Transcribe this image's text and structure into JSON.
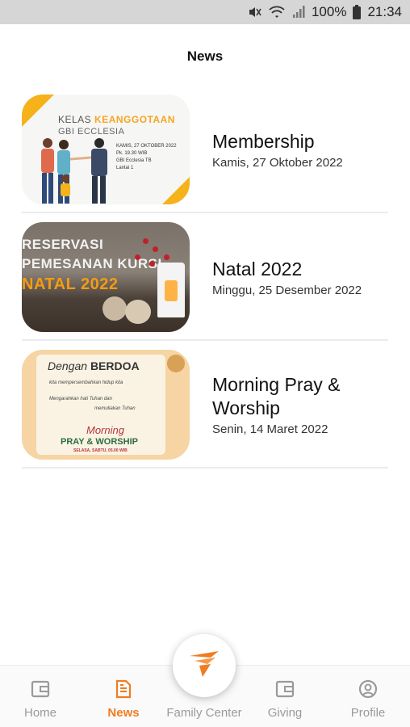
{
  "status_bar": {
    "battery": "100%",
    "time": "21:34"
  },
  "header": {
    "title": "News"
  },
  "news": [
    {
      "title": "Membership",
      "date": "Kamis, 27 Oktober 2022",
      "thumb": {
        "kelas": "KELAS ",
        "keanggotaan": "KEANGGOTAAN",
        "gbi": "GBI ECCLESIA",
        "info1": "KAMIS, 27 OKTOBER 2022",
        "info2": "Pk. 19.30 WIB",
        "info3": "GBI Ecclesia TB",
        "info4": "Lantai 1"
      }
    },
    {
      "title": "Natal 2022",
      "date": "Minggu, 25 Desember 2022",
      "thumb": {
        "line1": "RESERVASI",
        "line2": "PEMESANAN KURSI",
        "line3": "NATAL 2022"
      }
    },
    {
      "title": "Morning Pray & Worship",
      "date": "Senin, 14 Maret 2022",
      "thumb": {
        "dengan": "Dengan ",
        "berdoa": "BERDOA",
        "line1": "kita mempersembahkan hidup kita",
        "line2": "Mengarahkan hati Tuhan dan",
        "line3": "memuliakan Tuhan",
        "morning": "Morning",
        "pray_worship": "PRAY & WORSHIP",
        "schedule": "SELASA, SABTU, 05.00 WIB"
      }
    }
  ],
  "bottom_nav": {
    "items": [
      {
        "label": "Home",
        "icon": "wallet-icon",
        "active": false
      },
      {
        "label": "News",
        "icon": "document-icon",
        "active": true
      },
      {
        "label": "Family Center",
        "icon": "family-center-logo-icon",
        "active": false
      },
      {
        "label": "Giving",
        "icon": "wallet-icon",
        "active": false
      },
      {
        "label": "Profile",
        "icon": "user-circle-icon",
        "active": false
      }
    ]
  },
  "colors": {
    "accent": "#f07c22",
    "inactive": "#9a9a9a",
    "status_bar": "#d6d6d6"
  }
}
